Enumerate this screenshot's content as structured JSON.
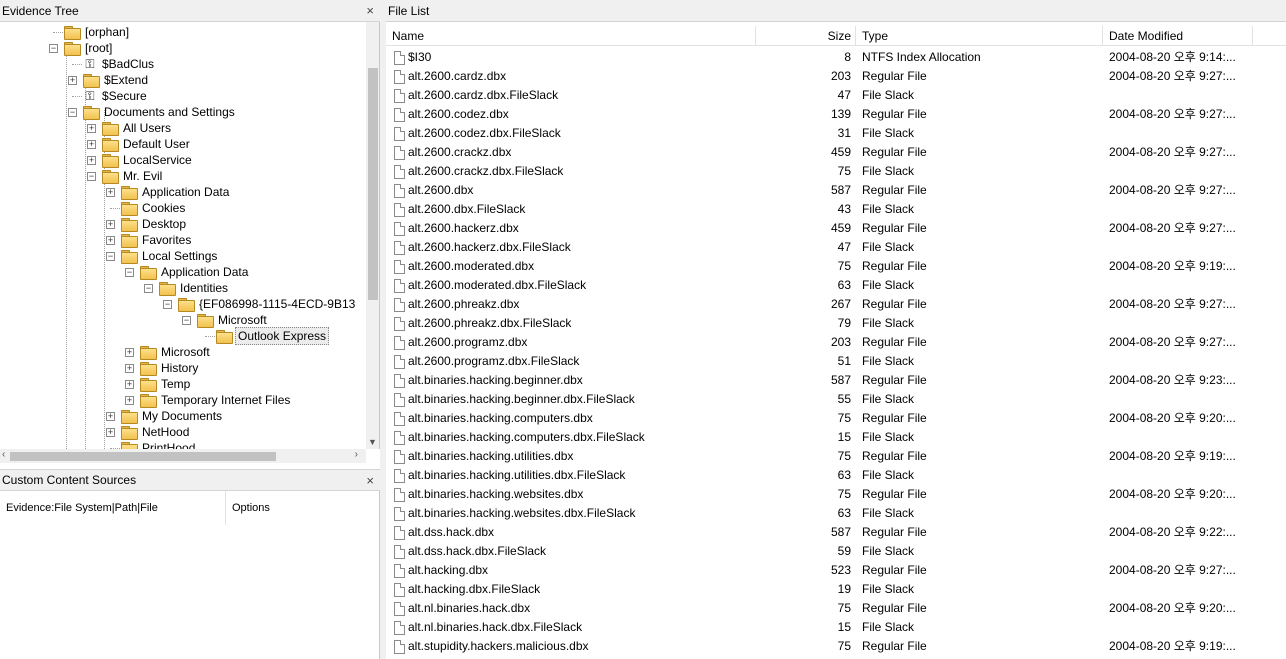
{
  "evidence_tree": {
    "title": "Evidence Tree",
    "close_glyph": "×",
    "nodes": [
      {
        "label": "[orphan]",
        "icon": "folder",
        "expander": ""
      },
      {
        "label": "[root]",
        "icon": "folder",
        "expander": "−"
      },
      {
        "label": "$BadClus",
        "icon": "system",
        "expander": ""
      },
      {
        "label": "$Extend",
        "icon": "folder",
        "expander": "+"
      },
      {
        "label": "$Secure",
        "icon": "system",
        "expander": ""
      },
      {
        "label": "Documents and Settings",
        "icon": "folder",
        "expander": "−"
      },
      {
        "label": "All Users",
        "icon": "folder",
        "expander": "+"
      },
      {
        "label": "Default User",
        "icon": "folder",
        "expander": "+"
      },
      {
        "label": "LocalService",
        "icon": "folder",
        "expander": "+"
      },
      {
        "label": "Mr. Evil",
        "icon": "folder",
        "expander": "−"
      },
      {
        "label": "Application Data",
        "icon": "folder",
        "expander": "+"
      },
      {
        "label": "Cookies",
        "icon": "folder",
        "expander": ""
      },
      {
        "label": "Desktop",
        "icon": "folder",
        "expander": "+"
      },
      {
        "label": "Favorites",
        "icon": "folder",
        "expander": "+"
      },
      {
        "label": "Local Settings",
        "icon": "folder",
        "expander": "−"
      },
      {
        "label": "Application Data",
        "icon": "folder",
        "expander": "−"
      },
      {
        "label": "Identities",
        "icon": "folder",
        "expander": "−"
      },
      {
        "label": "{EF086998-1115-4ECD-9B13",
        "icon": "folder",
        "expander": "−"
      },
      {
        "label": "Microsoft",
        "icon": "folder",
        "expander": "−"
      },
      {
        "label": "Outlook Express",
        "icon": "folder",
        "expander": ""
      },
      {
        "label": "Microsoft",
        "icon": "folder",
        "expander": "+"
      },
      {
        "label": "History",
        "icon": "folder",
        "expander": "+"
      },
      {
        "label": "Temp",
        "icon": "folder",
        "expander": "+"
      },
      {
        "label": "Temporary Internet Files",
        "icon": "folder",
        "expander": "+"
      },
      {
        "label": "My Documents",
        "icon": "folder",
        "expander": "+"
      },
      {
        "label": "NetHood",
        "icon": "folder",
        "expander": "+"
      },
      {
        "label": "PrintHood",
        "icon": "folder",
        "expander": ""
      }
    ],
    "selected_node": "Outlook Express"
  },
  "custom_content_sources": {
    "title": "Custom Content Sources",
    "close_glyph": "×",
    "columns": [
      "Evidence:File System|Path|File",
      "Options"
    ]
  },
  "file_list": {
    "title": "File List",
    "columns": {
      "name": "Name",
      "size": "Size",
      "type": "Type",
      "date": "Date Modified"
    },
    "rows": [
      {
        "name": "$I30",
        "size": "8",
        "type": "NTFS Index Allocation",
        "date": "2004-08-20 오후 9:14:..."
      },
      {
        "name": "alt.2600.cardz.dbx",
        "size": "203",
        "type": "Regular File",
        "date": "2004-08-20 오후 9:27:..."
      },
      {
        "name": "alt.2600.cardz.dbx.FileSlack",
        "size": "47",
        "type": "File Slack",
        "date": ""
      },
      {
        "name": "alt.2600.codez.dbx",
        "size": "139",
        "type": "Regular File",
        "date": "2004-08-20 오후 9:27:..."
      },
      {
        "name": "alt.2600.codez.dbx.FileSlack",
        "size": "31",
        "type": "File Slack",
        "date": ""
      },
      {
        "name": "alt.2600.crackz.dbx",
        "size": "459",
        "type": "Regular File",
        "date": "2004-08-20 오후 9:27:..."
      },
      {
        "name": "alt.2600.crackz.dbx.FileSlack",
        "size": "75",
        "type": "File Slack",
        "date": ""
      },
      {
        "name": "alt.2600.dbx",
        "size": "587",
        "type": "Regular File",
        "date": "2004-08-20 오후 9:27:..."
      },
      {
        "name": "alt.2600.dbx.FileSlack",
        "size": "43",
        "type": "File Slack",
        "date": ""
      },
      {
        "name": "alt.2600.hackerz.dbx",
        "size": "459",
        "type": "Regular File",
        "date": "2004-08-20 오후 9:27:..."
      },
      {
        "name": "alt.2600.hackerz.dbx.FileSlack",
        "size": "47",
        "type": "File Slack",
        "date": ""
      },
      {
        "name": "alt.2600.moderated.dbx",
        "size": "75",
        "type": "Regular File",
        "date": "2004-08-20 오후 9:19:..."
      },
      {
        "name": "alt.2600.moderated.dbx.FileSlack",
        "size": "63",
        "type": "File Slack",
        "date": ""
      },
      {
        "name": "alt.2600.phreakz.dbx",
        "size": "267",
        "type": "Regular File",
        "date": "2004-08-20 오후 9:27:..."
      },
      {
        "name": "alt.2600.phreakz.dbx.FileSlack",
        "size": "79",
        "type": "File Slack",
        "date": ""
      },
      {
        "name": "alt.2600.programz.dbx",
        "size": "203",
        "type": "Regular File",
        "date": "2004-08-20 오후 9:27:..."
      },
      {
        "name": "alt.2600.programz.dbx.FileSlack",
        "size": "51",
        "type": "File Slack",
        "date": ""
      },
      {
        "name": "alt.binaries.hacking.beginner.dbx",
        "size": "587",
        "type": "Regular File",
        "date": "2004-08-20 오후 9:23:..."
      },
      {
        "name": "alt.binaries.hacking.beginner.dbx.FileSlack",
        "size": "55",
        "type": "File Slack",
        "date": ""
      },
      {
        "name": "alt.binaries.hacking.computers.dbx",
        "size": "75",
        "type": "Regular File",
        "date": "2004-08-20 오후 9:20:..."
      },
      {
        "name": "alt.binaries.hacking.computers.dbx.FileSlack",
        "size": "15",
        "type": "File Slack",
        "date": ""
      },
      {
        "name": "alt.binaries.hacking.utilities.dbx",
        "size": "75",
        "type": "Regular File",
        "date": "2004-08-20 오후 9:19:..."
      },
      {
        "name": "alt.binaries.hacking.utilities.dbx.FileSlack",
        "size": "63",
        "type": "File Slack",
        "date": ""
      },
      {
        "name": "alt.binaries.hacking.websites.dbx",
        "size": "75",
        "type": "Regular File",
        "date": "2004-08-20 오후 9:20:..."
      },
      {
        "name": "alt.binaries.hacking.websites.dbx.FileSlack",
        "size": "63",
        "type": "File Slack",
        "date": ""
      },
      {
        "name": "alt.dss.hack.dbx",
        "size": "587",
        "type": "Regular File",
        "date": "2004-08-20 오후 9:22:..."
      },
      {
        "name": "alt.dss.hack.dbx.FileSlack",
        "size": "59",
        "type": "File Slack",
        "date": ""
      },
      {
        "name": "alt.hacking.dbx",
        "size": "523",
        "type": "Regular File",
        "date": "2004-08-20 오후 9:27:..."
      },
      {
        "name": "alt.hacking.dbx.FileSlack",
        "size": "19",
        "type": "File Slack",
        "date": ""
      },
      {
        "name": "alt.nl.binaries.hack.dbx",
        "size": "75",
        "type": "Regular File",
        "date": "2004-08-20 오후 9:20:..."
      },
      {
        "name": "alt.nl.binaries.hack.dbx.FileSlack",
        "size": "15",
        "type": "File Slack",
        "date": ""
      },
      {
        "name": "alt.stupidity.hackers.malicious.dbx",
        "size": "75",
        "type": "Regular File",
        "date": "2004-08-20 오후 9:19:..."
      }
    ]
  }
}
